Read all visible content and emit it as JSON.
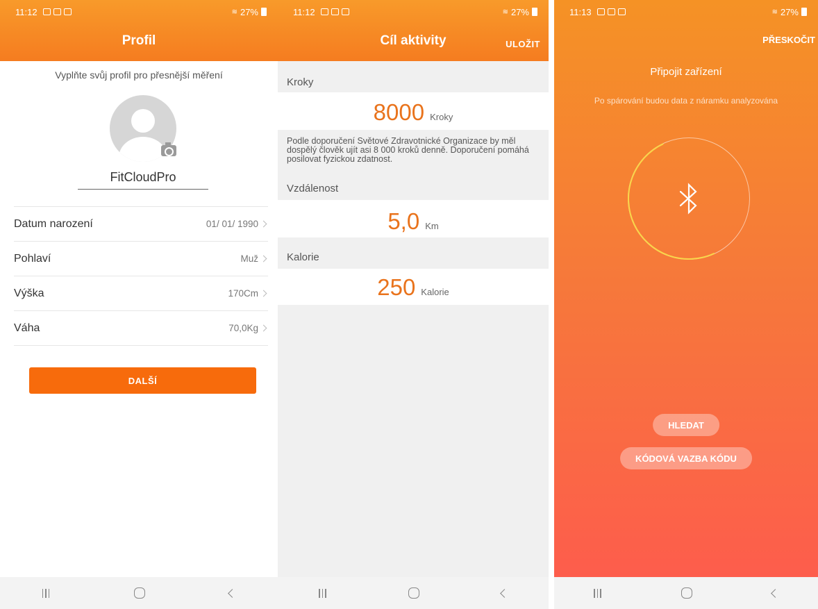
{
  "status": {
    "time_1": "11:12",
    "time_2": "11:12",
    "time_3": "11:13",
    "battery": "27%"
  },
  "profile": {
    "title": "Profil",
    "subtitle": "Vyplňte svůj profil pro přesnější měření",
    "username": "FitCloudPro",
    "rows": [
      {
        "label": "Datum narození",
        "value": "01/ 01/ 1990"
      },
      {
        "label": "Pohlaví",
        "value": "Muž"
      },
      {
        "label": "Výška",
        "value": "170Cm"
      },
      {
        "label": "Váha",
        "value": "70,0Kg"
      }
    ],
    "next_label": "DALŠÍ"
  },
  "activity": {
    "title": "Cíl aktivity",
    "save_label": "ULOŽIT",
    "steps_label": "Kroky",
    "steps_value": "8000",
    "steps_unit": "Kroky",
    "description": "Podle doporučení Světové Zdravotnické Organizace by měl dospělý člověk ujít asi 8 000 kroků denně. Doporučení pomáhá posilovat fyzickou zdatnost.",
    "distance_label": "Vzdálenost",
    "distance_value": "5,0",
    "distance_unit": "Km",
    "calories_label": "Kalorie",
    "calories_value": "250",
    "calories_unit": "Kalorie"
  },
  "connect": {
    "skip_label": "PŘESKOČIT",
    "title": "Připojit zařízení",
    "subtitle": "Po spárování budou data z náramku analyzována",
    "search_label": "HLEDAT",
    "code_label": "KÓDOVÁ VAZBA KÓDU"
  },
  "icons": {
    "status_icons": [
      "gallery-icon",
      "youtube-icon",
      "check-icon"
    ],
    "avatar": "user-icon",
    "camera": "camera-icon",
    "bluetooth": "bluetooth-icon"
  },
  "colors": {
    "accent": "#f57c20",
    "button": "#f76b0c",
    "value_orange": "#e9731c",
    "gradient_bottom": "#fe5a4e"
  }
}
